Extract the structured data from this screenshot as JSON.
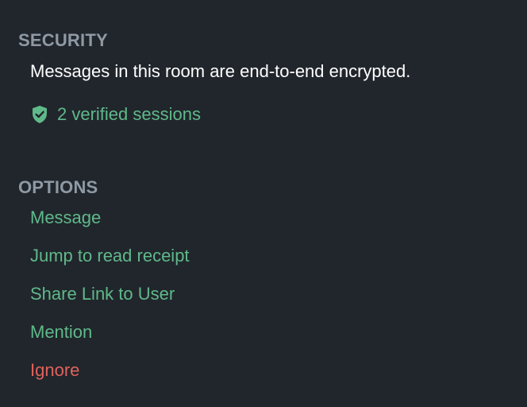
{
  "security": {
    "heading": "SECURITY",
    "description": "Messages in this room are end-to-end encrypted.",
    "verified_sessions": "2 verified sessions",
    "shield_icon": "shield-check-icon"
  },
  "options": {
    "heading": "OPTIONS",
    "items": [
      {
        "label": "Message",
        "tone": "normal"
      },
      {
        "label": "Jump to read receipt",
        "tone": "normal"
      },
      {
        "label": "Share Link to User",
        "tone": "normal"
      },
      {
        "label": "Mention",
        "tone": "normal"
      },
      {
        "label": "Ignore",
        "tone": "danger"
      }
    ]
  },
  "colors": {
    "background": "#21262c",
    "heading": "#8e99a4",
    "text": "#ffffff",
    "accent": "#5fb98a",
    "danger": "#e0625c"
  }
}
